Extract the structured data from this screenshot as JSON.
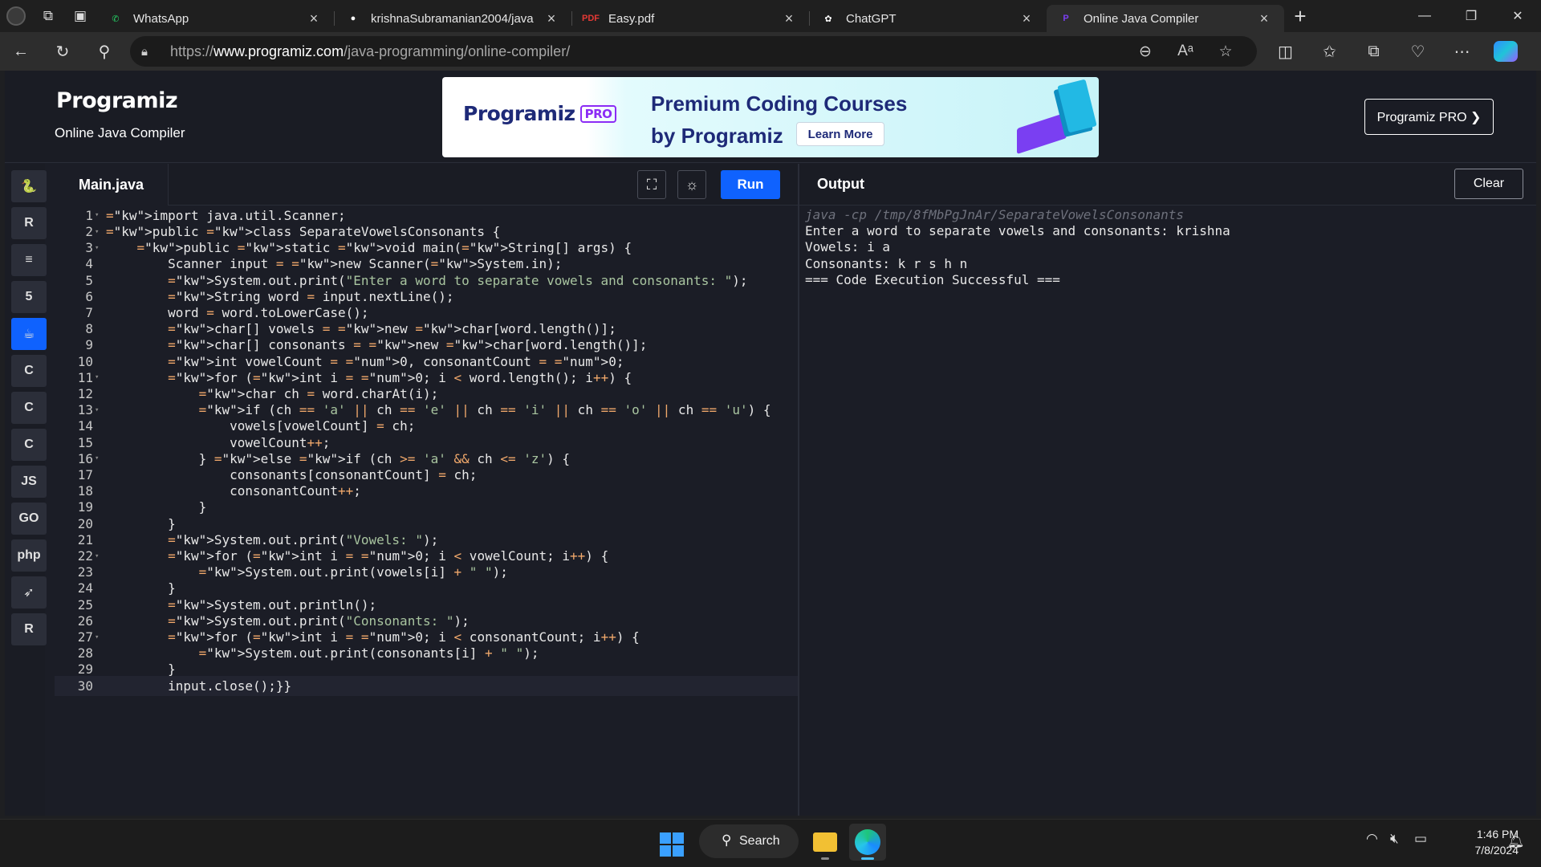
{
  "browser": {
    "tabs": [
      {
        "title": "WhatsApp",
        "icon": "whatsapp-icon",
        "color": "#25d366",
        "glyph": "✆"
      },
      {
        "title": "krishnaSubramanian2004/java",
        "icon": "github-icon",
        "color": "#ffffff",
        "glyph": "●"
      },
      {
        "title": "Easy.pdf",
        "icon": "pdf-icon",
        "color": "#e53935",
        "glyph": "PDF"
      },
      {
        "title": "ChatGPT",
        "icon": "chatgpt-icon",
        "color": "#ffffff",
        "glyph": "✿"
      },
      {
        "title": "Online Java Compiler",
        "icon": "programiz-icon",
        "color": "#7b3ff2",
        "glyph": "P"
      }
    ],
    "url_prefix": "https://",
    "url_host": "www.programiz.com",
    "url_path": "/java-programming/online-compiler/"
  },
  "header": {
    "logo": "Programiz",
    "subtitle": "Online Java Compiler",
    "banner_logo": "Programiz",
    "banner_pro": "PRO",
    "banner_line1": "Premium Coding Courses",
    "banner_line2": "by Programiz",
    "banner_cta": "Learn More",
    "pro_button": "Programiz PRO ❯"
  },
  "rail": {
    "languages": [
      {
        "name": "python-icon",
        "glyph": "🐍"
      },
      {
        "name": "r-icon",
        "glyph": "R"
      },
      {
        "name": "sql-icon",
        "glyph": "≡"
      },
      {
        "name": "html-icon",
        "glyph": "5"
      },
      {
        "name": "java-icon",
        "glyph": "☕",
        "active": true
      },
      {
        "name": "c-icon",
        "glyph": "C"
      },
      {
        "name": "cpp-icon",
        "glyph": "C"
      },
      {
        "name": "csharp-icon",
        "glyph": "C"
      },
      {
        "name": "js-icon",
        "glyph": "JS"
      },
      {
        "name": "go-icon",
        "glyph": "GO"
      },
      {
        "name": "php-icon",
        "glyph": "php"
      },
      {
        "name": "swift-icon",
        "glyph": "➶"
      },
      {
        "name": "rust-icon",
        "glyph": "R"
      }
    ]
  },
  "editor": {
    "file_name": "Main.java",
    "run_label": "Run",
    "lines": [
      "import java.util.Scanner;",
      "public class SeparateVowelsConsonants {",
      "    public static void main(String[] args) {",
      "        Scanner input = new Scanner(System.in);",
      "        System.out.print(\"Enter a word to separate vowels and consonants: \");",
      "        String word = input.nextLine();",
      "        word = word.toLowerCase();",
      "        char[] vowels = new char[word.length()];",
      "        char[] consonants = new char[word.length()];",
      "        int vowelCount = 0, consonantCount = 0;",
      "        for (int i = 0; i < word.length(); i++) {",
      "            char ch = word.charAt(i);",
      "            if (ch == 'a' || ch == 'e' || ch == 'i' || ch == 'o' || ch == 'u') {",
      "                vowels[vowelCount] = ch;",
      "                vowelCount++;",
      "            } else if (ch >= 'a' && ch <= 'z') {",
      "                consonants[consonantCount] = ch;",
      "                consonantCount++;",
      "            }",
      "        }",
      "        System.out.print(\"Vowels: \");",
      "        for (int i = 0; i < vowelCount; i++) {",
      "            System.out.print(vowels[i] + \" \");",
      "        }",
      "        System.out.println();",
      "        System.out.print(\"Consonants: \");",
      "        for (int i = 0; i < consonantCount; i++) {",
      "            System.out.print(consonants[i] + \" \");",
      "        }",
      "        input.close();}}"
    ],
    "fold_lines": [
      1,
      2,
      3,
      11,
      13,
      16,
      22,
      27
    ]
  },
  "output": {
    "title": "Output",
    "clear_label": "Clear",
    "lines": [
      "java -cp /tmp/8fMbPgJnAr/SeparateVowelsConsonants",
      "Enter a word to separate vowels and consonants: krishna",
      "Vowels: i a",
      "Consonants: k r s h n",
      "=== Code Execution Successful ==="
    ]
  },
  "taskbar": {
    "search_label": "Search",
    "time": "1:46 PM",
    "date": "7/8/2024"
  }
}
